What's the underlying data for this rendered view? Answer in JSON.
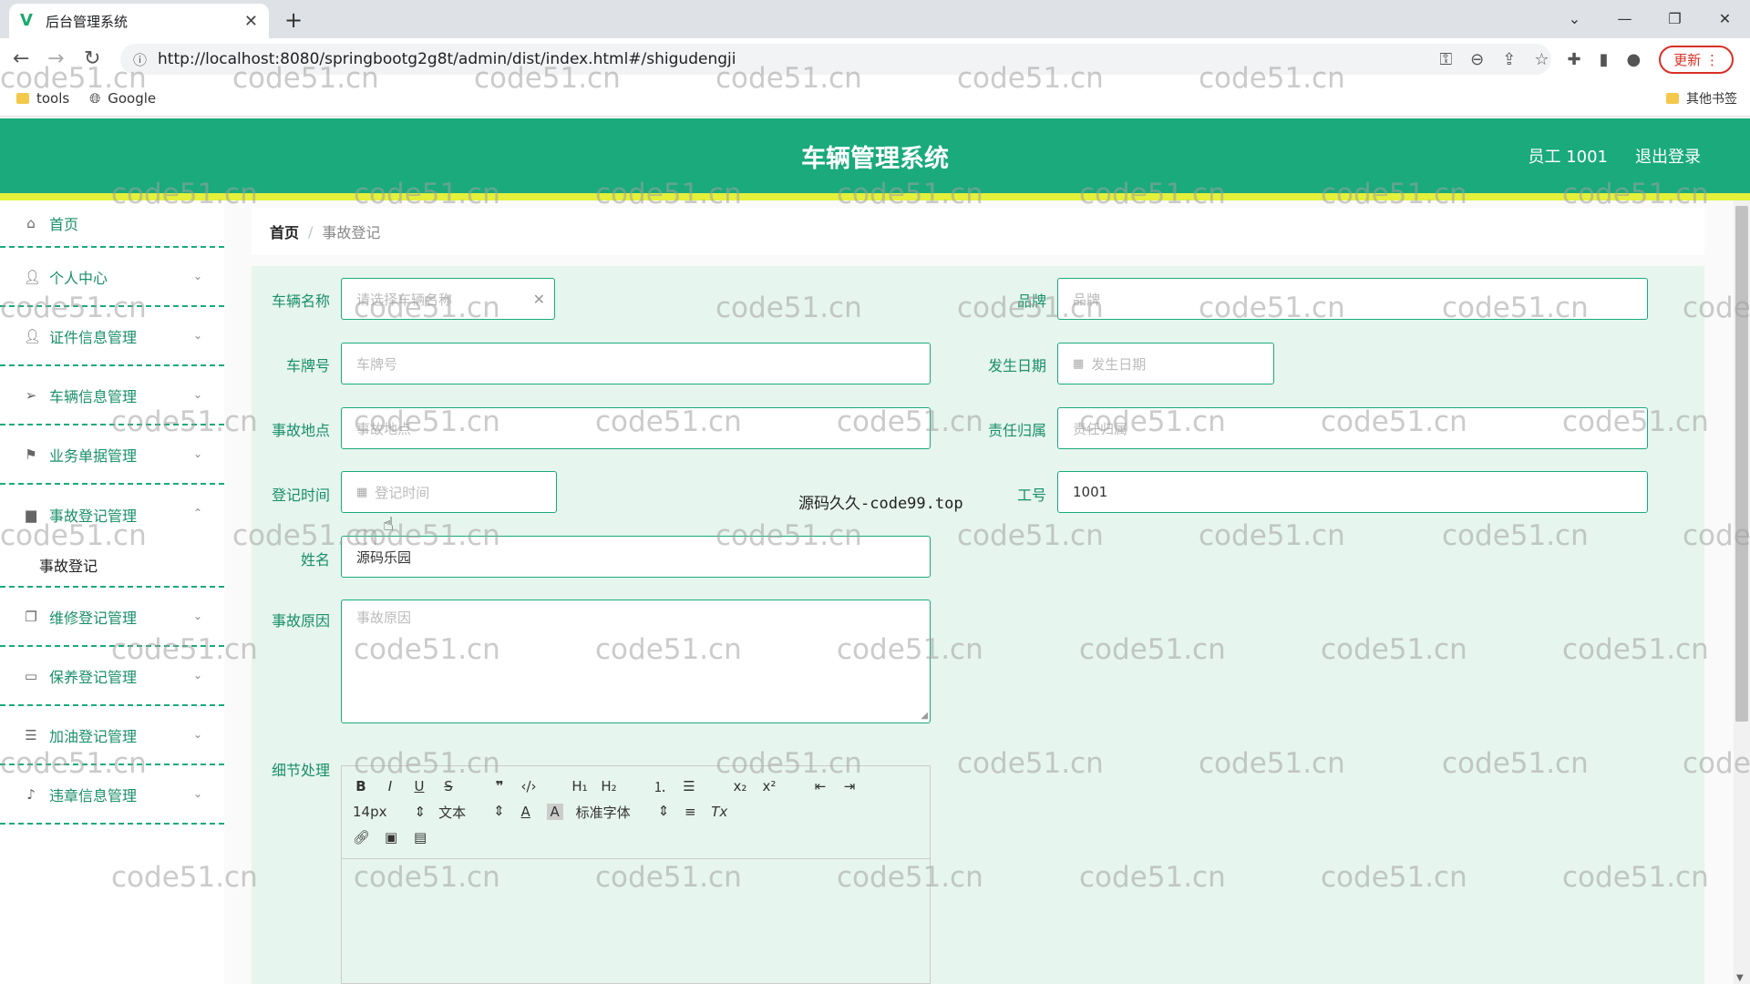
{
  "browser": {
    "tab_title": "后台管理系统",
    "tab_favicon": "V",
    "url": "http://localhost:8080/springbootg2g8t/admin/dist/index.html#/shigudengji",
    "update_label": "更新",
    "bookmarks": [
      "tools",
      "Google"
    ],
    "other_bookmarks": "其他书签"
  },
  "header": {
    "title": "车辆管理系统",
    "user": "员工 1001",
    "logout": "退出登录"
  },
  "sidebar": {
    "home": "首页",
    "items": [
      {
        "label": "个人中心",
        "icon": "user-icon"
      },
      {
        "label": "证件信息管理",
        "icon": "user-icon"
      },
      {
        "label": "车辆信息管理",
        "icon": "send-icon"
      },
      {
        "label": "业务单据管理",
        "icon": "flag-icon"
      },
      {
        "label": "事故登记管理",
        "icon": "car-icon"
      },
      {
        "label": "维修登记管理",
        "icon": "copy-icon"
      },
      {
        "label": "保养登记管理",
        "icon": "message-icon"
      },
      {
        "label": "加油登记管理",
        "icon": "list-icon"
      },
      {
        "label": "违章信息管理",
        "icon": "bell-icon"
      }
    ],
    "submenu_active": "事故登记"
  },
  "breadcrumb": {
    "home": "首页",
    "separator": "/",
    "current": "事故登记"
  },
  "form": {
    "vehicle_name": {
      "label": "车辆名称",
      "placeholder": "请选择车辆名称"
    },
    "brand": {
      "label": "品牌",
      "placeholder": "品牌"
    },
    "plate": {
      "label": "车牌号",
      "placeholder": "车牌号"
    },
    "date": {
      "label": "发生日期",
      "placeholder": "发生日期"
    },
    "location": {
      "label": "事故地点",
      "placeholder": "事故地点"
    },
    "responsibility": {
      "label": "责任归属",
      "placeholder": "责任归属"
    },
    "reg_time": {
      "label": "登记时间",
      "placeholder": "登记时间"
    },
    "job_no": {
      "label": "工号",
      "value": "1001"
    },
    "name": {
      "label": "姓名",
      "value": "源码乐园"
    },
    "reason": {
      "label": "事故原因",
      "placeholder": "事故原因"
    },
    "detail": {
      "label": "细节处理"
    }
  },
  "center_note": "源码久久-code99.top",
  "editor": {
    "font_size": "14px",
    "text_type": "文本",
    "font_family": "标准字体"
  },
  "watermark": "code51.cn"
}
